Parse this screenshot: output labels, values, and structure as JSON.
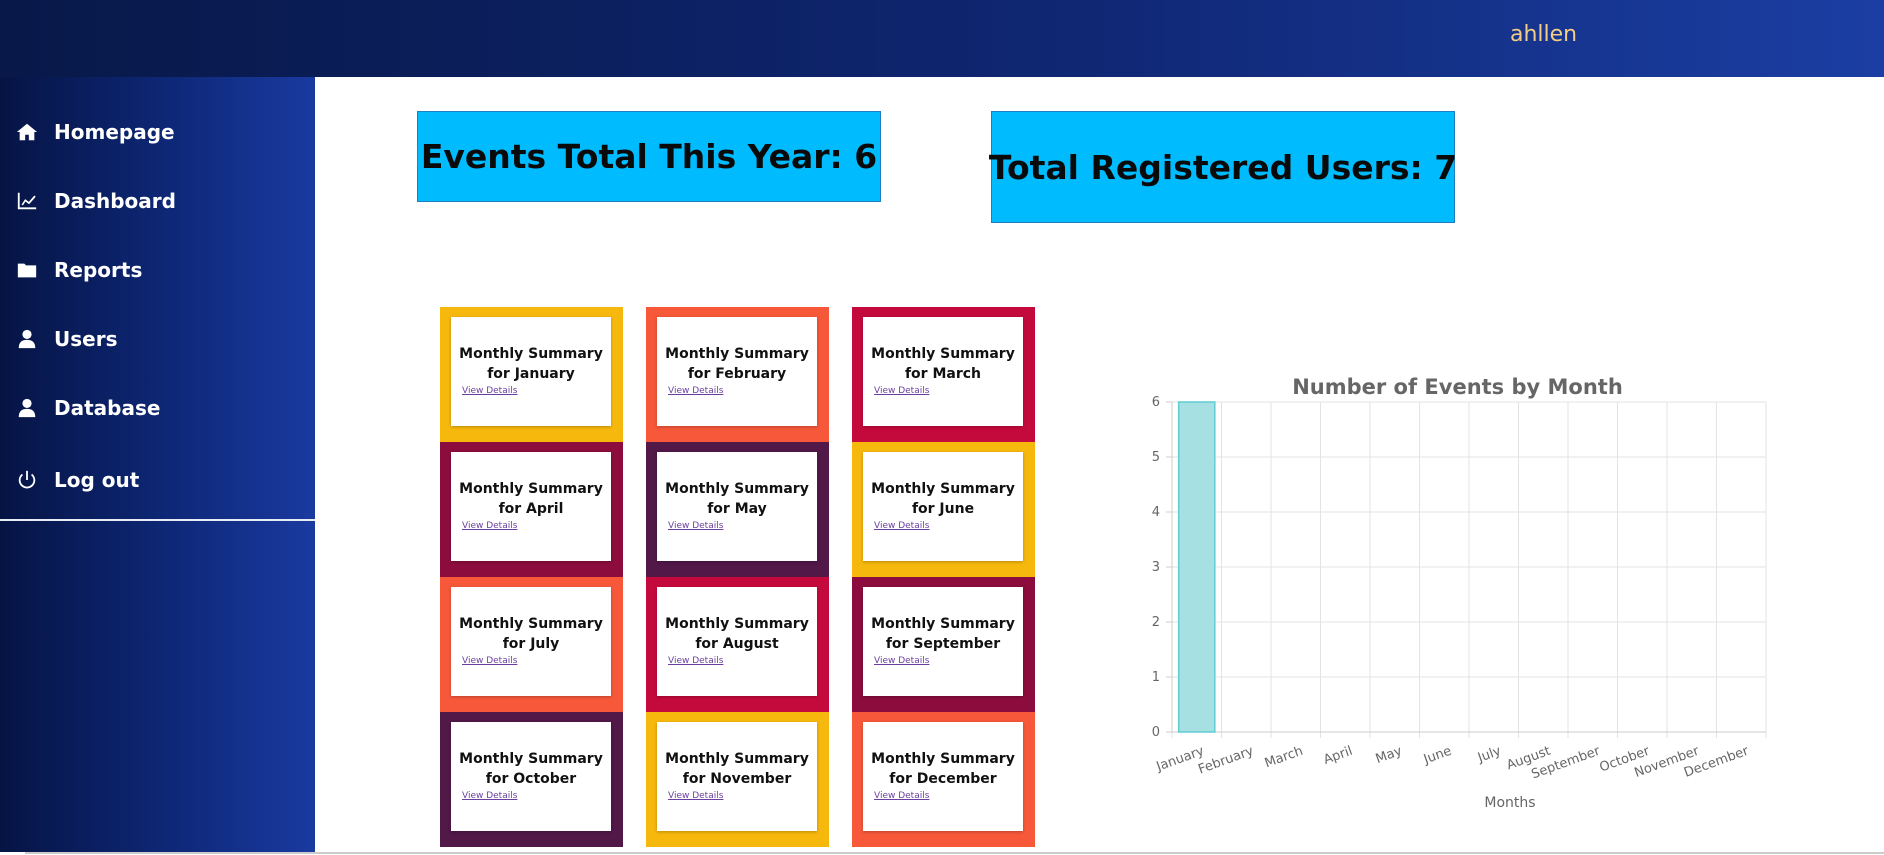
{
  "header": {
    "username": "ahllen"
  },
  "sidebar": {
    "items": [
      {
        "label": "Homepage",
        "icon": "home-icon"
      },
      {
        "label": "Dashboard",
        "icon": "chart-line-icon"
      },
      {
        "label": "Reports",
        "icon": "folder-icon"
      },
      {
        "label": "Users",
        "icon": "user-icon"
      },
      {
        "label": "Database",
        "icon": "user-icon"
      }
    ],
    "logout": {
      "label": "Log out",
      "icon": "power-icon"
    }
  },
  "stats": {
    "events_total": "Events Total This Year: 6",
    "registered_users": "Total Registered Users: 7"
  },
  "cards": {
    "link_label": "View Details",
    "items": [
      {
        "line1": "Monthly Summary",
        "line2": "for January",
        "color": "#f7b80d"
      },
      {
        "line1": "Monthly Summary",
        "line2": "for February",
        "color": "#f7583a"
      },
      {
        "line1": "Monthly Summary",
        "line2": "for March",
        "color": "#c40a3c"
      },
      {
        "line1": "Monthly Summary",
        "line2": "for April",
        "color": "#8c0d3d"
      },
      {
        "line1": "Monthly Summary",
        "line2": "for May",
        "color": "#511848"
      },
      {
        "line1": "Monthly Summary",
        "line2": "for June",
        "color": "#f7b80d"
      },
      {
        "line1": "Monthly Summary",
        "line2": "for July",
        "color": "#f7583a"
      },
      {
        "line1": "Monthly Summary",
        "line2": "for August",
        "color": "#c40a3c"
      },
      {
        "line1": "Monthly Summary",
        "line2": "for September",
        "color": "#8c0d3d"
      },
      {
        "line1": "Monthly Summary",
        "line2": "for October",
        "color": "#511848"
      },
      {
        "line1": "Monthly Summary",
        "line2": "for November",
        "color": "#f7b80d"
      },
      {
        "line1": "Monthly Summary",
        "line2": "for December",
        "color": "#f7583a"
      }
    ]
  },
  "chart_data": {
    "type": "bar",
    "title": "Number of Events by Month",
    "xlabel": "Months",
    "ylabel": "",
    "categories": [
      "January",
      "February",
      "March",
      "April",
      "May",
      "June",
      "July",
      "August",
      "September",
      "October",
      "November",
      "December"
    ],
    "values": [
      6,
      0,
      0,
      0,
      0,
      0,
      0,
      0,
      0,
      0,
      0,
      0
    ],
    "ylim": [
      0,
      6
    ],
    "yticks": [
      0,
      1,
      2,
      3,
      4,
      5,
      6
    ],
    "grid": true,
    "legend": "none",
    "bar_color": "#a6e0e3",
    "bar_border": "#5fcdd2"
  }
}
